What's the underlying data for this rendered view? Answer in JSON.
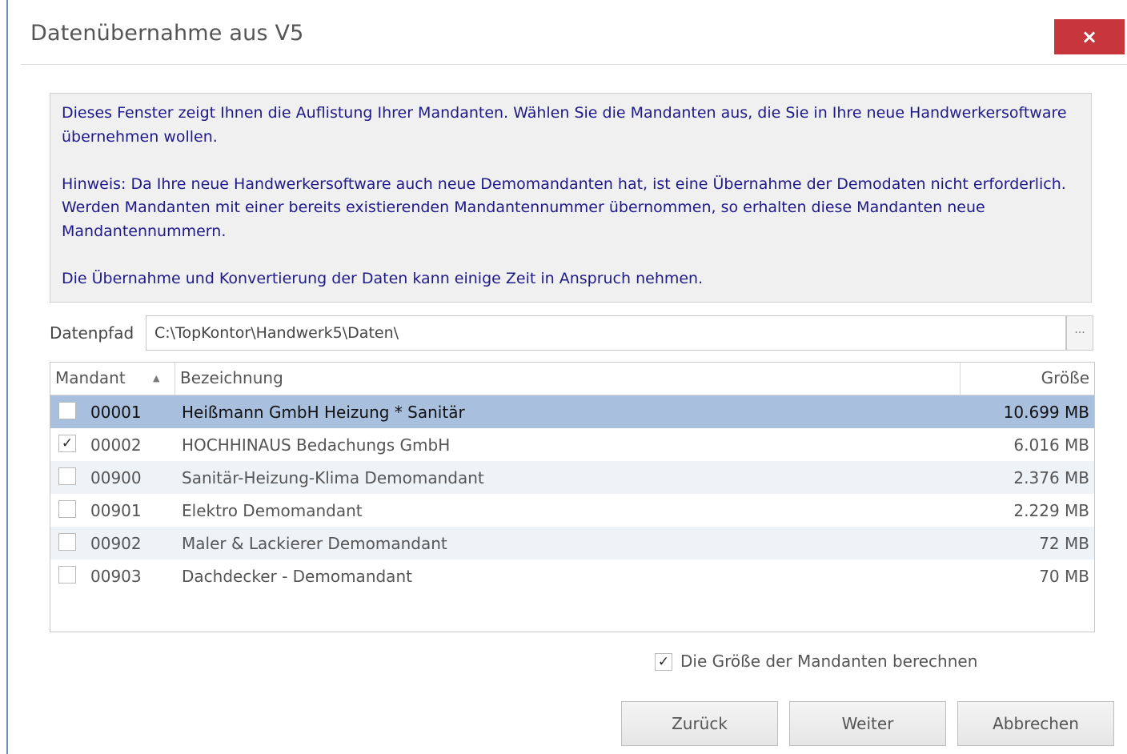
{
  "dialog": {
    "title": "Datenübernahme aus V5",
    "close_label": "×"
  },
  "info": {
    "paragraph1": "Dieses Fenster zeigt Ihnen die Auflistung Ihrer Mandanten. Wählen Sie die Mandanten aus, die Sie in Ihre neue Handwerkersoftware übernehmen wollen.",
    "paragraph2": "Hinweis: Da Ihre neue Handwerkersoftware auch neue Demomandanten hat, ist eine Übernahme der Demodaten nicht erforderlich. Werden Mandanten mit einer bereits existierenden Mandantennummer übernommen, so erhalten diese Mandanten neue Mandantennummern.",
    "paragraph3": "Die Übernahme und Konvertierung der Daten kann einige Zeit in Anspruch nehmen."
  },
  "path": {
    "label": "Datenpfad",
    "value": "C:\\TopKontor\\Handwerk5\\Daten\\",
    "browse_label": "···"
  },
  "grid": {
    "headers": {
      "mandant": "Mandant",
      "sort_icon": "▲",
      "bezeichnung": "Bezeichnung",
      "groesse": "Größe"
    },
    "rows": [
      {
        "checked": false,
        "check": "",
        "nummer": "00001",
        "bezeichnung": "Heißmann GmbH Heizung * Sanitär",
        "groesse": "10.699 MB",
        "selected": true
      },
      {
        "checked": true,
        "check": "✓",
        "nummer": "00002",
        "bezeichnung": "HOCHHINAUS Bedachungs GmbH",
        "groesse": "6.016 MB",
        "selected": false
      },
      {
        "checked": false,
        "check": "",
        "nummer": "00900",
        "bezeichnung": "Sanitär-Heizung-Klima Demomandant",
        "groesse": "2.376 MB",
        "selected": false
      },
      {
        "checked": false,
        "check": "",
        "nummer": "00901",
        "bezeichnung": "Elektro Demomandant",
        "groesse": "2.229 MB",
        "selected": false
      },
      {
        "checked": false,
        "check": "",
        "nummer": "00902",
        "bezeichnung": "Maler & Lackierer Demomandant",
        "groesse": "72 MB",
        "selected": false
      },
      {
        "checked": false,
        "check": "",
        "nummer": "00903",
        "bezeichnung": "Dachdecker - Demomandant",
        "groesse": "70 MB",
        "selected": false
      }
    ]
  },
  "calc_size": {
    "checked": true,
    "check": "✓",
    "label": "Die Größe der Mandanten berechnen"
  },
  "buttons": {
    "back": "Zurück",
    "next": "Weiter",
    "cancel": "Abbrechen"
  }
}
